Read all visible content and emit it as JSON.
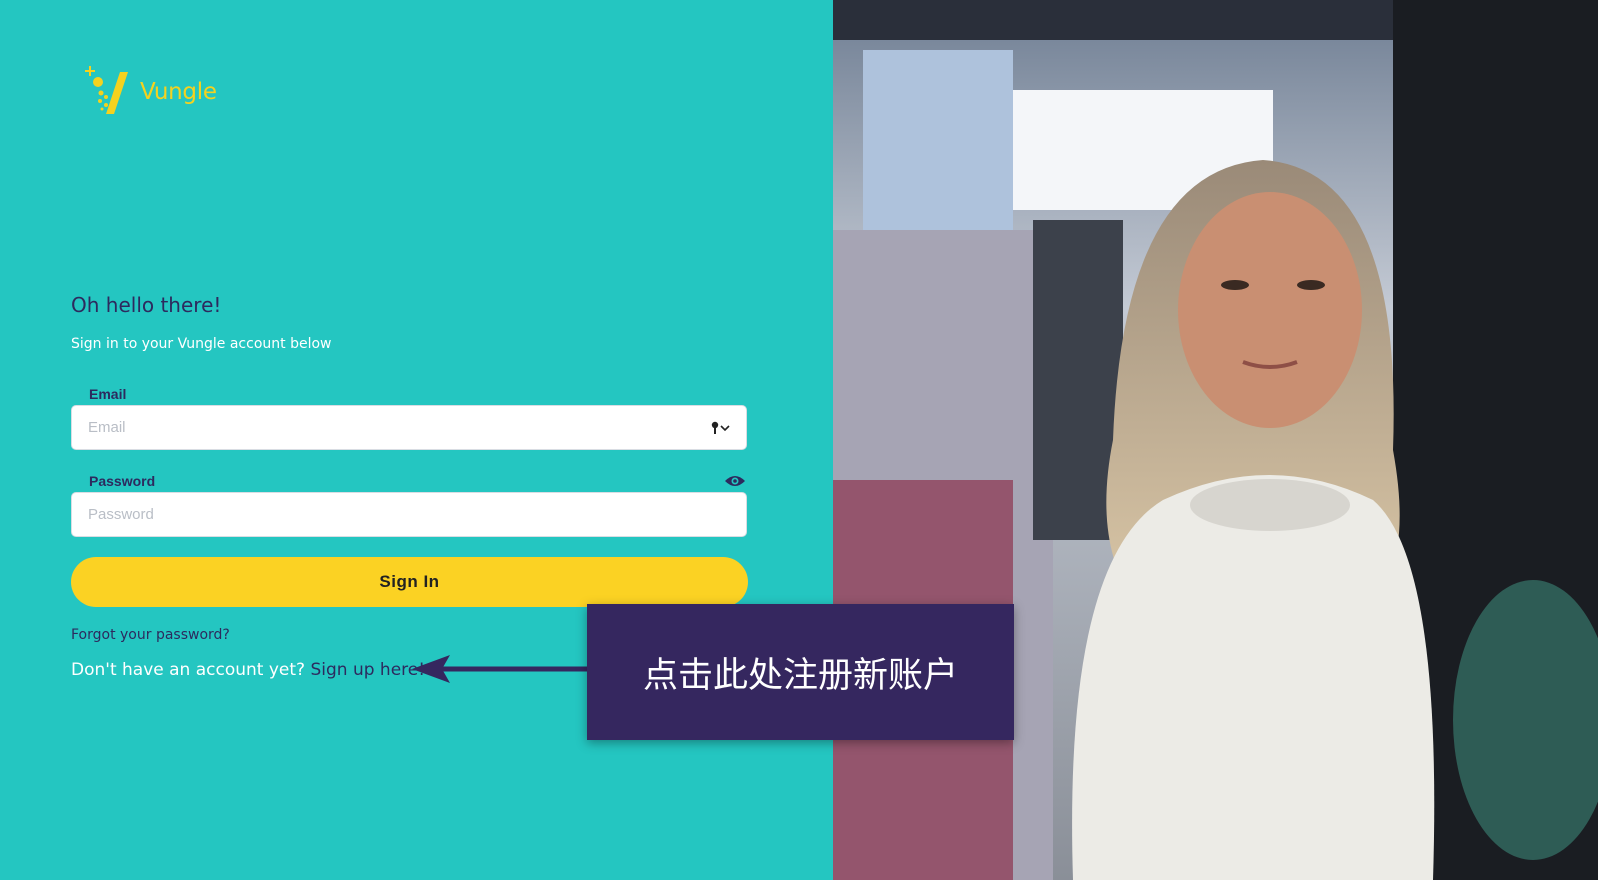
{
  "brand": {
    "name": "Vungle",
    "logo_icon": "vungle-logo-icon",
    "accent_color": "#f4d21f"
  },
  "login": {
    "greeting": "Oh hello there!",
    "subtitle": "Sign in to your Vungle account below",
    "email": {
      "label": "Email",
      "placeholder": "Email",
      "value": "",
      "icon": "key-dropdown-icon"
    },
    "password": {
      "label": "Password",
      "placeholder": "Password",
      "value": "",
      "icon": "eye-icon"
    },
    "sign_in_label": "Sign In",
    "forgot_password": "Forgot your password?",
    "no_account_text": "Don't have an account yet?",
    "signup_link": "Sign up here!"
  },
  "annotation": {
    "callout_text": "点击此处注册新账户",
    "arrow_icon": "arrow-left-icon"
  },
  "colors": {
    "background": "#24c6c1",
    "primary_text": "#2d2a5e",
    "button": "#fbd223",
    "callout": "#35275f"
  }
}
